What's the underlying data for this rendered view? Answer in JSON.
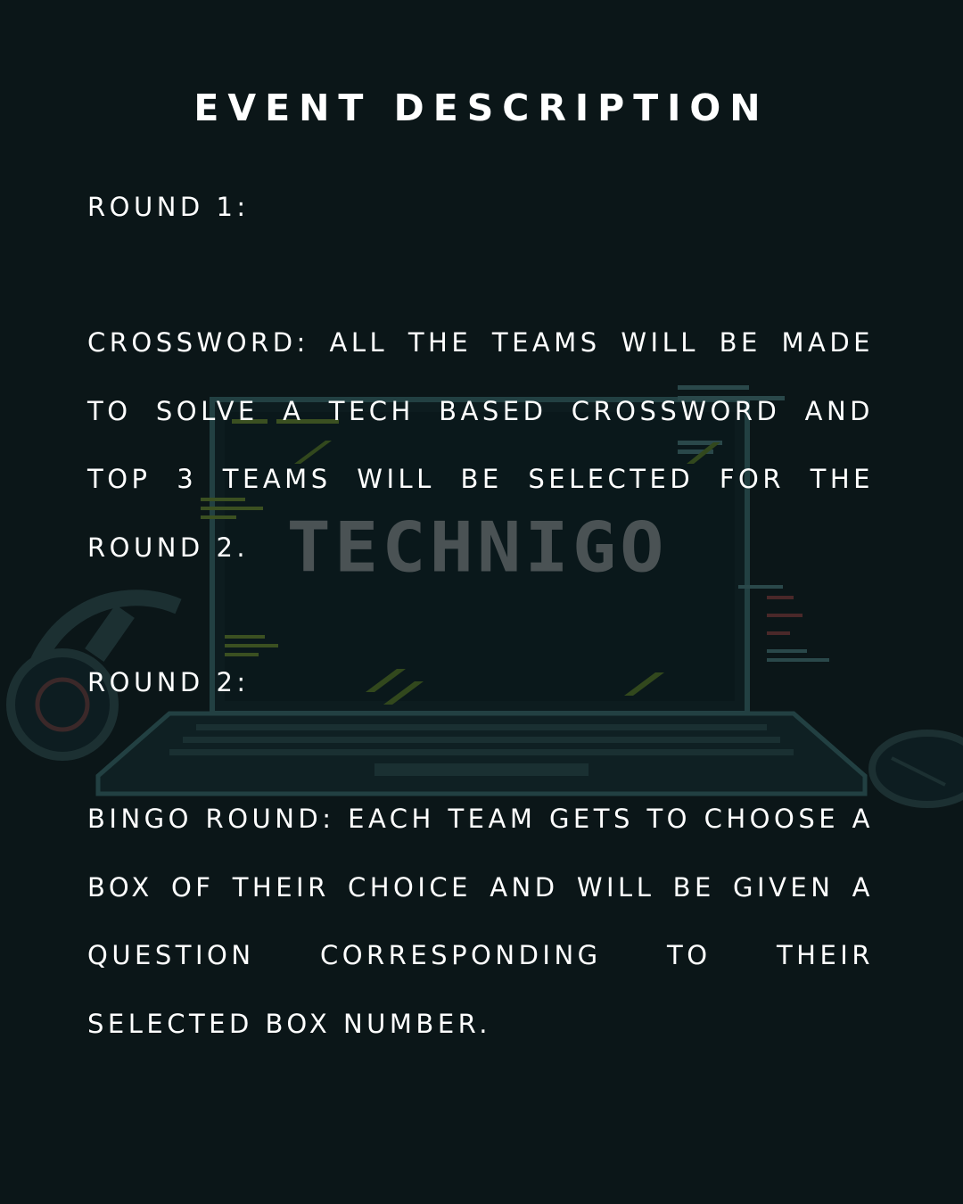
{
  "title": "EVENT DESCRIPTION",
  "logo_text": "TECHNIGO",
  "rounds": [
    {
      "heading": "ROUND 1:",
      "description": "CROSSWORD: ALL THE TEAMS WILL BE MADE TO SOLVE A TECH BASED CROSSWORD AND TOP 3 TEAMS WILL BE SELECTED FOR THE ROUND 2."
    },
    {
      "heading": "ROUND 2:",
      "description": "BINGO ROUND: EACH TEAM GETS TO CHOOSE A BOX OF THEIR CHOICE AND WILL BE GIVEN A QUESTION CORRESPONDING TO THEIR SELECTED BOX NUMBER."
    }
  ],
  "background_icons": [
    "laptop-icon",
    "headphones-icon",
    "mouse-icon"
  ],
  "colors": {
    "background": "#0b1618",
    "text": "#ffffff",
    "logo": "#4a5254",
    "accent_green": "#6b8a2a",
    "accent_teal": "#2a5a5e"
  }
}
